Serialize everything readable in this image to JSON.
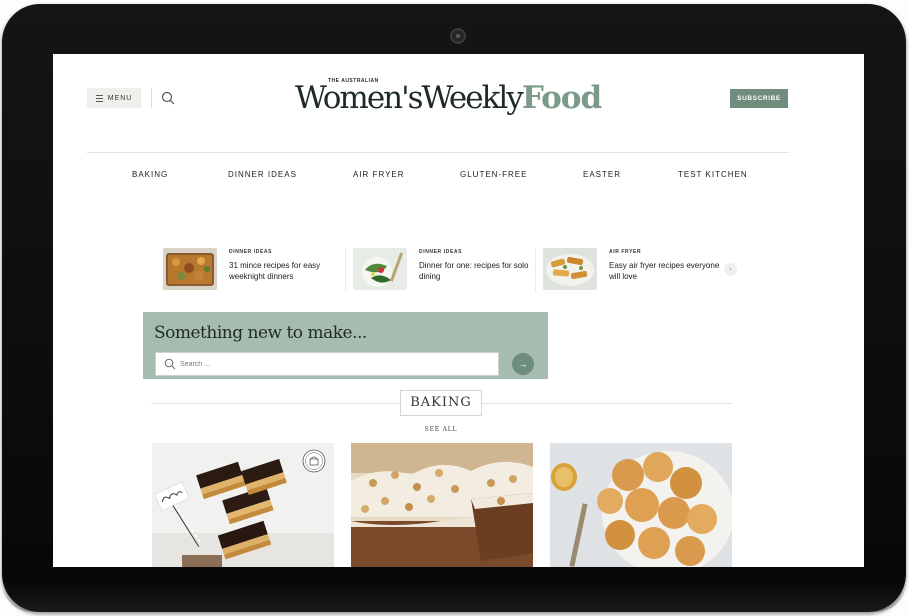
{
  "header": {
    "menu_label": "MENU",
    "logo_small": "THE AUSTRALIAN",
    "logo_main": "Women'sWeekly",
    "logo_food": "Food",
    "subscribe_label": "SUBSCRIBE"
  },
  "nav": {
    "items": [
      "BAKING",
      "DINNER IDEAS",
      "AIR FRYER",
      "GLUTEN-FREE",
      "EASTER",
      "TEST KITCHEN"
    ]
  },
  "carousel": {
    "cards": [
      {
        "category": "DINNER IDEAS",
        "title": "31 mince recipes for easy weeknight dinners"
      },
      {
        "category": "DINNER IDEAS",
        "title": "Dinner for one: recipes for solo dining"
      },
      {
        "category": "AIR FRYER",
        "title": "Easy air fryer recipes everyone will love"
      }
    ]
  },
  "search": {
    "heading": "Something new to make...",
    "placeholder": "Search ..."
  },
  "section": {
    "title": "BAKING",
    "see_all": "SEE ALL",
    "recipes": [
      {
        "image": "caramel-slice"
      },
      {
        "image": "carrot-cake"
      },
      {
        "image": "scones"
      }
    ]
  },
  "colors": {
    "brand_green": "#6f8c7c",
    "search_panel": "#a6bcae",
    "logo_food": "#7b9a87"
  }
}
